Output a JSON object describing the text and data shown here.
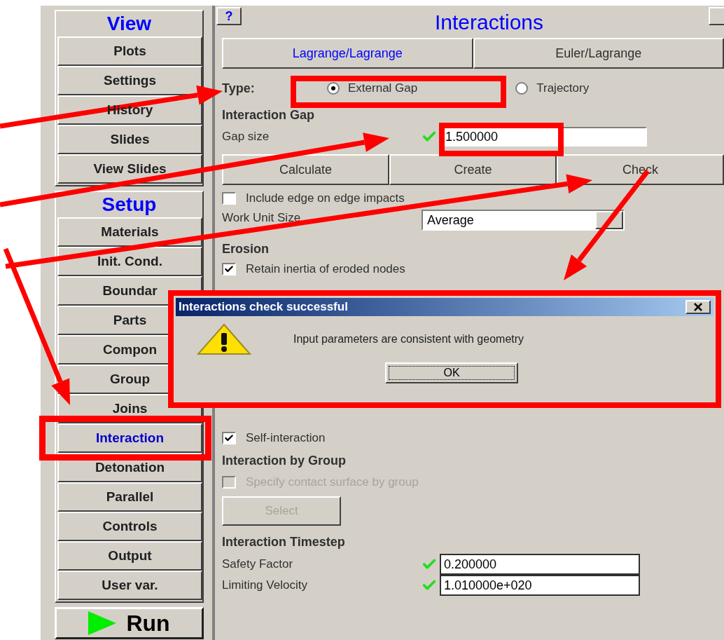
{
  "sidebar": {
    "sections": [
      {
        "title": "View",
        "items": [
          {
            "label": "Plots",
            "selected": false
          },
          {
            "label": "Settings",
            "selected": false
          },
          {
            "label": "History",
            "selected": false
          },
          {
            "label": "Slides",
            "selected": false
          },
          {
            "label": "View Slides",
            "selected": false
          }
        ]
      },
      {
        "title": "Setup",
        "items": [
          {
            "label": "Materials",
            "selected": false
          },
          {
            "label": "Init. Cond.",
            "selected": false
          },
          {
            "label": "Boundar",
            "selected": false
          },
          {
            "label": "Parts",
            "selected": false
          },
          {
            "label": "Compon",
            "selected": false
          },
          {
            "label": "Group",
            "selected": false
          },
          {
            "label": "Joins",
            "selected": false
          },
          {
            "label": "Interaction",
            "selected": true
          },
          {
            "label": "Detonation",
            "selected": false
          },
          {
            "label": "Parallel",
            "selected": false
          },
          {
            "label": "Controls",
            "selected": false
          },
          {
            "label": "Output",
            "selected": false
          },
          {
            "label": "User var.",
            "selected": false
          }
        ]
      }
    ],
    "run_button": "Run"
  },
  "panel": {
    "help_button": "?",
    "title": "Interactions",
    "tabs": [
      {
        "label": "Lagrange/Lagrange",
        "selected": true
      },
      {
        "label": "Euler/Lagrange",
        "selected": false
      }
    ],
    "type_label": "Type:",
    "type_options": [
      {
        "label": "External Gap",
        "selected": true
      },
      {
        "label": "Trajectory",
        "selected": false
      }
    ],
    "gap_heading": "Interaction Gap",
    "gap_size": {
      "label": "Gap size",
      "value": "1.500000"
    },
    "actions": [
      "Calculate",
      "Create",
      "Check"
    ],
    "include_edge": {
      "label": "Include edge on edge impacts",
      "checked": false
    },
    "work_unit_size": {
      "label": "Work Unit Size",
      "value": "Average"
    },
    "erosion_heading": "Erosion",
    "retain_inertia": {
      "label": "Retain inertia of eroded nodes",
      "checked": true
    },
    "self_interaction": {
      "label": "Self-interaction",
      "checked": true
    },
    "group_heading": "Interaction by Group",
    "specify_contact": {
      "label": "Specify contact surface by group",
      "checked": false,
      "disabled": true
    },
    "select_button": {
      "label": "Select",
      "disabled": true
    },
    "timestep_heading": "Interaction Timestep",
    "timestep_fields": [
      {
        "label": "Safety Factor",
        "value": "0.200000"
      },
      {
        "label": "Limiting Velocity",
        "value": "1.010000e+020"
      }
    ]
  },
  "dialog": {
    "title": "Interactions check successful",
    "message": "Input parameters are consistent with geometry",
    "ok_button": "OK"
  }
}
